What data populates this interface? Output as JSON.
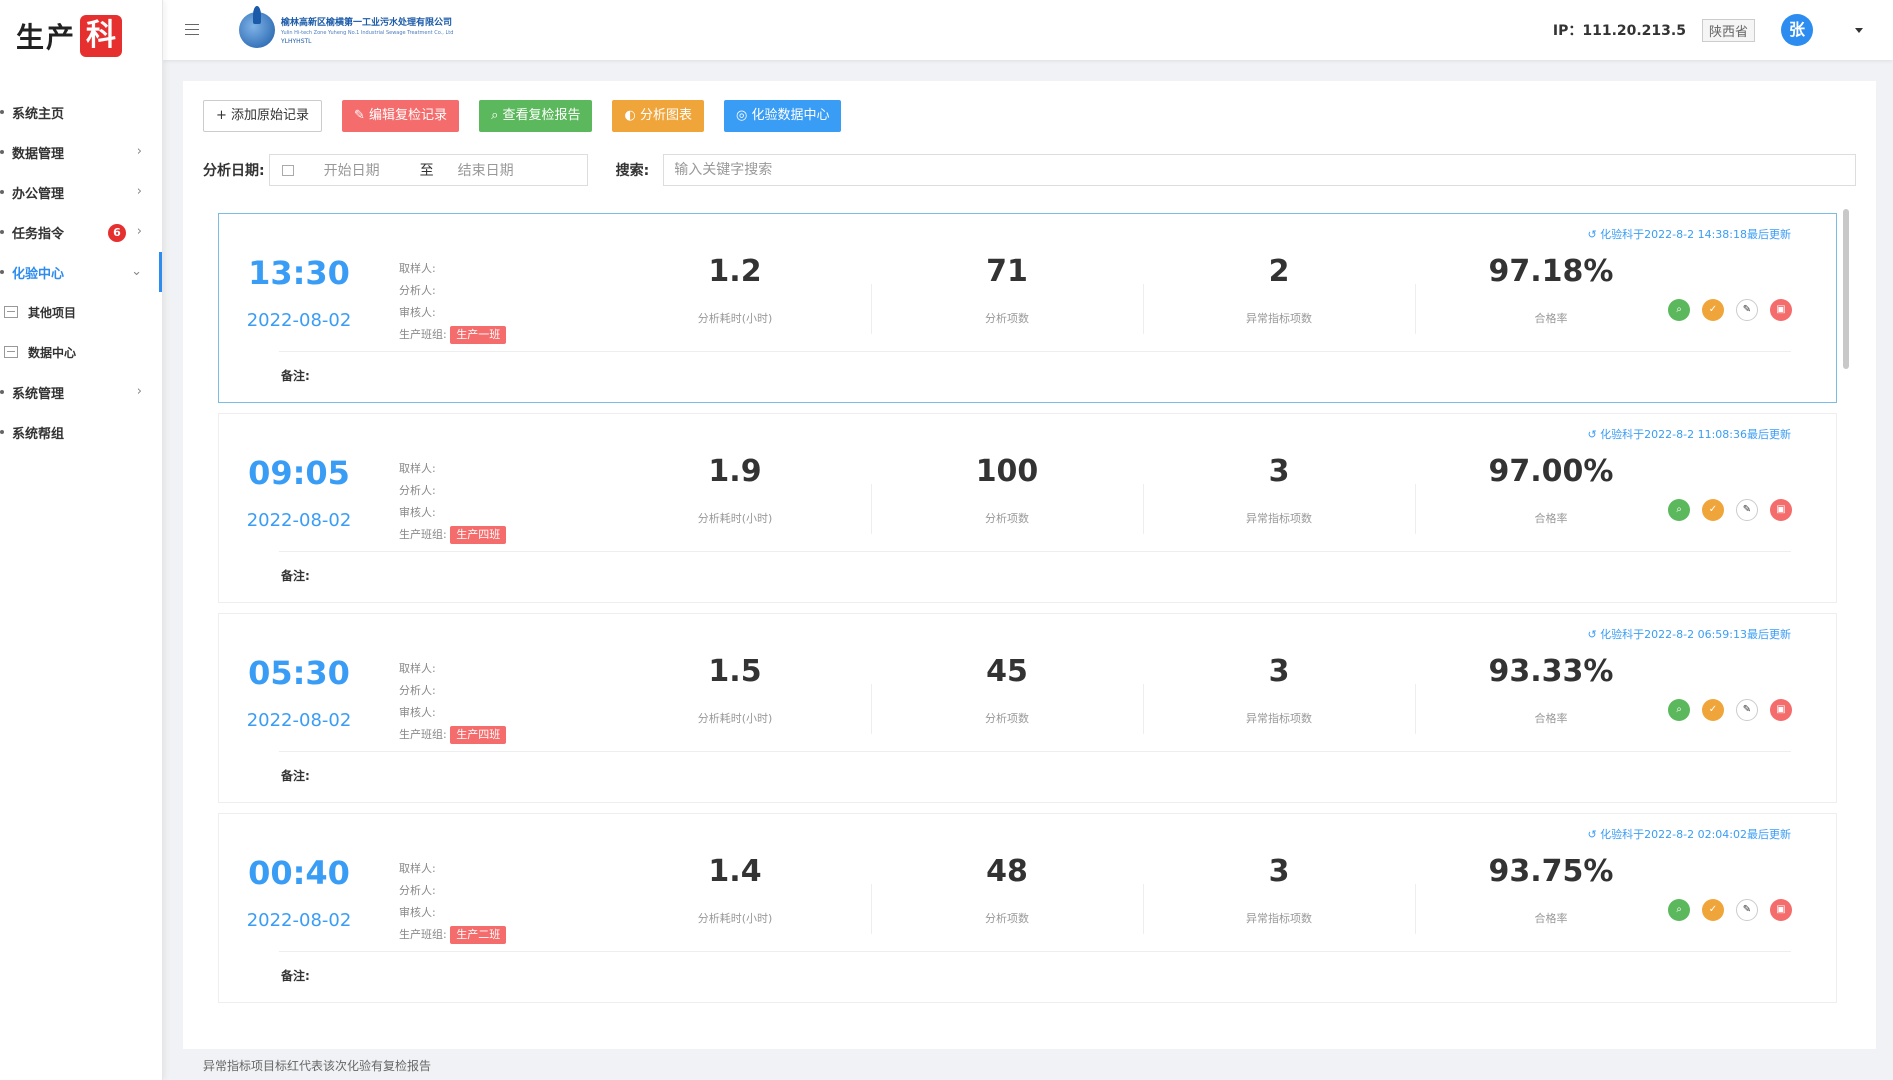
{
  "sidebar": {
    "brand_text": "生产",
    "brand_badge": "科",
    "items": [
      {
        "label": "系统主页"
      },
      {
        "label": "数据管理",
        "arrow": "›"
      },
      {
        "label": "办公管理",
        "arrow": "›"
      },
      {
        "label": "任务指令",
        "arrow": "›",
        "badge": "6"
      },
      {
        "label": "化验中心",
        "arrow": "⌄"
      },
      {
        "label": "系统管理",
        "arrow": "›"
      },
      {
        "label": "系统帮组"
      }
    ],
    "subitems": [
      {
        "label": "其他项目"
      },
      {
        "label": "数据中心"
      }
    ]
  },
  "header": {
    "menu_icon": "hamburger-icon",
    "logo_cn": "榆林高新区榆横第一工业污水处理有限公司",
    "logo_en": "Yulin Hi-tech Zone Yuheng No.1 Industrial Sewage Treatment Co., Ltd",
    "logo_abbr": "YLHYHSTL",
    "ip": "IP：111.20.213.5",
    "province": "陕西省",
    "avatar": "张"
  },
  "toolbar": {
    "add": "+ 添加原始记录",
    "edit_recheck": "✎ 编辑复检记录",
    "view_report": "⌕ 查看复检报告",
    "analysis_chart": "◐ 分析图表",
    "data_center": "◎ 化验数据中心"
  },
  "filter": {
    "date_label": "分析日期:",
    "start_placeholder": "开始日期",
    "to": "至",
    "end_placeholder": "结束日期",
    "search_label": "搜索:",
    "search_placeholder": "输入关键字搜索"
  },
  "labels": {
    "sampler": "取样人:",
    "analyst": "分析人:",
    "reviewer": "审核人:",
    "shift": "生产班组:",
    "duration": "分析耗时(小时)",
    "items": "分析项数",
    "abnormal": "异常指标项数",
    "pass_rate": "合格率",
    "note": "备注:"
  },
  "records": [
    {
      "time": "13:30",
      "date": "2022-08-02",
      "shift": "生产一班",
      "duration": "1.2",
      "items": "71",
      "abnormal": "2",
      "pass_rate": "97.18%",
      "updated": "↺ 化验科于2022-8-2 14:38:18最后更新"
    },
    {
      "time": "09:05",
      "date": "2022-08-02",
      "shift": "生产四班",
      "duration": "1.9",
      "items": "100",
      "abnormal": "3",
      "pass_rate": "97.00%",
      "updated": "↺ 化验科于2022-8-2 11:08:36最后更新"
    },
    {
      "time": "05:30",
      "date": "2022-08-02",
      "shift": "生产四班",
      "duration": "1.5",
      "items": "45",
      "abnormal": "3",
      "pass_rate": "93.33%",
      "updated": "↺ 化验科于2022-8-2 06:59:13最后更新"
    },
    {
      "time": "00:40",
      "date": "2022-08-02",
      "shift": "生产二班",
      "duration": "1.4",
      "items": "48",
      "abnormal": "3",
      "pass_rate": "93.75%",
      "updated": "↺ 化验科于2022-8-2 02:04:02最后更新"
    }
  ],
  "footer": "异常指标项目标红代表该次化验有复检报告"
}
